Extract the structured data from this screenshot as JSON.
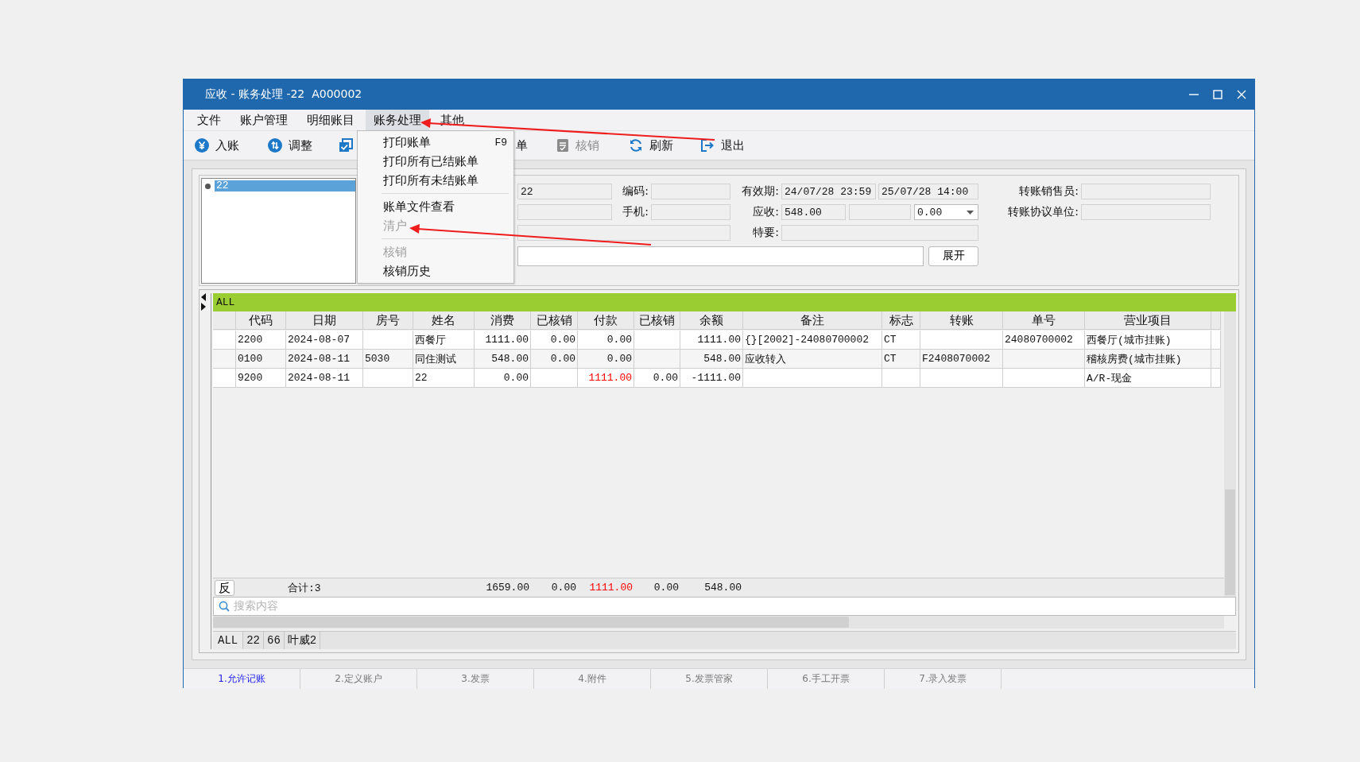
{
  "window": {
    "title": "应收 - 账务处理 -22  A000002"
  },
  "menu_bar": [
    {
      "label": "文件",
      "selected": false
    },
    {
      "label": "账户管理",
      "selected": false
    },
    {
      "label": "明细账目",
      "selected": false
    },
    {
      "label": "账务处理",
      "selected": true
    },
    {
      "label": "其他",
      "selected": false
    }
  ],
  "dropdown_menu": [
    {
      "kind": "item",
      "label": "打印账单",
      "shortcut": "F9",
      "disabled": false
    },
    {
      "kind": "item",
      "label": "打印所有已结账单",
      "disabled": false
    },
    {
      "kind": "item",
      "label": "打印所有未结账单",
      "disabled": false
    },
    {
      "kind": "separator"
    },
    {
      "kind": "item",
      "label": "账单文件查看",
      "disabled": false
    },
    {
      "kind": "item",
      "label": "清户",
      "disabled": true
    },
    {
      "kind": "separator"
    },
    {
      "kind": "item",
      "label": "核销",
      "disabled": true
    },
    {
      "kind": "item",
      "label": "核销历史",
      "disabled": false
    }
  ],
  "toolbar": [
    {
      "kind": "yen",
      "label": "入账",
      "disabled": false
    },
    {
      "kind": "updown",
      "label": "调整",
      "disabled": false
    },
    {
      "kind": "check",
      "disabled": false
    },
    {
      "kind": "text",
      "label": "单",
      "disabled": false
    },
    {
      "kind": "doc",
      "label": "核销",
      "disabled": true
    },
    {
      "kind": "refresh",
      "label": "刷新",
      "disabled": false
    },
    {
      "kind": "exit",
      "label": "退出",
      "disabled": false
    }
  ],
  "account_list": [
    {
      "label": "22",
      "selected": true
    }
  ],
  "form_rows": [
    [
      {
        "kind": "field",
        "value": "22"
      },
      {
        "kind": "label",
        "text": "编码:"
      },
      {
        "kind": "field"
      },
      {
        "kind": "label",
        "text": "有效期:"
      },
      {
        "kind": "field",
        "value": "24/07/28 23:59"
      },
      {
        "kind": "field",
        "value": "25/07/28 14:00"
      },
      {
        "kind": "label",
        "text": "转账销售员:"
      },
      {
        "kind": "field"
      }
    ],
    [
      {
        "kind": "field"
      },
      {
        "kind": "label",
        "text": "手机:"
      },
      {
        "kind": "field"
      },
      {
        "kind": "label",
        "text": "应收:"
      },
      {
        "kind": "field",
        "value": "548.00"
      },
      {
        "kind": "field"
      },
      {
        "kind": "dropdown",
        "value": "0.00"
      },
      {
        "kind": "label",
        "text": "转账协议单位:"
      },
      {
        "kind": "field"
      }
    ],
    [
      {
        "kind": "field"
      },
      {
        "kind": "label",
        "text": "特要:"
      },
      {
        "kind": "field"
      }
    ],
    [
      {
        "kind": "input"
      },
      {
        "kind": "button",
        "label": "展开"
      }
    ]
  ],
  "grid": {
    "group_label": "ALL",
    "columns": [
      "代码",
      "日期",
      "房号",
      "姓名",
      "消费",
      "已核销",
      "付款",
      "已核销",
      "余额",
      "备注",
      "标志",
      "转账",
      "单号",
      "营业项目"
    ],
    "rows": [
      [
        "2200",
        "2024-08-07",
        null,
        "西餐厅",
        "1111.00",
        "0.00",
        "0.00",
        null,
        "1111.00",
        "{}[2002]-24080700002",
        "CT",
        null,
        "24080700002",
        "西餐厅(城市挂账)"
      ],
      [
        "0100",
        "2024-08-11",
        "5030",
        "同住测试",
        "548.00",
        "0.00",
        "0.00",
        null,
        "548.00",
        "应收转入",
        "CT",
        "F2408070002",
        null,
        "稽核房费(城市挂账)"
      ],
      [
        "9200",
        "2024-08-11",
        null,
        "22",
        "0.00",
        null,
        {
          "text": "1111.00",
          "color": "#ff0000"
        },
        "0.00",
        "-1111.00",
        null,
        null,
        null,
        null,
        "A/R-现金"
      ]
    ],
    "reverse_button": "反",
    "total_row": {
      "label": "合计:3",
      "values": [
        "1659.00",
        "0.00",
        {
          "text": "1111.00",
          "color": "#ff0000"
        },
        "0.00",
        "548.00"
      ]
    },
    "search": {
      "placeholder": "搜索内容"
    },
    "group_tabs": [
      {
        "label": "ALL",
        "selected": true
      },
      {
        "label": "22",
        "selected": false
      },
      {
        "label": "66",
        "selected": false
      },
      {
        "label": "叶威2",
        "selected": false
      }
    ]
  },
  "bottom_tabs": [
    {
      "label": "1.允许记账",
      "selected": true
    },
    {
      "label": "2.定义账户",
      "selected": false
    },
    {
      "label": "3.发票",
      "selected": false
    },
    {
      "label": "4.附件",
      "selected": false
    },
    {
      "label": "5.发票管家",
      "selected": false
    },
    {
      "label": "6.手工开票",
      "selected": false
    },
    {
      "label": "7.录入发票",
      "selected": false
    }
  ]
}
